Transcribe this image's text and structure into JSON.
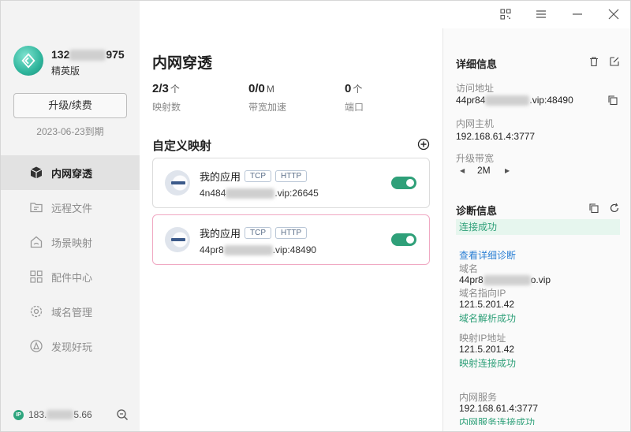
{
  "window": {
    "buttons": [
      "qrcode-icon",
      "menu-icon",
      "minimize-icon",
      "close-icon"
    ]
  },
  "sidebar": {
    "user_prefix": "132",
    "user_suffix": "975",
    "level": "精英版",
    "upgrade_label": "升级/续费",
    "expire": "2023-06-23到期",
    "items": [
      {
        "label": "内网穿透",
        "icon": "cube-icon",
        "active": true
      },
      {
        "label": "远程文件",
        "icon": "folder-icon",
        "active": false
      },
      {
        "label": "场景映射",
        "icon": "house-icon",
        "active": false
      },
      {
        "label": "配件中心",
        "icon": "grid-icon",
        "active": false
      },
      {
        "label": "域名管理",
        "icon": "gear-icon",
        "active": false
      },
      {
        "label": "发现好玩",
        "icon": "compass-icon",
        "active": false
      }
    ],
    "ip_badge": "IP",
    "ip_prefix": "183.",
    "ip_suffix": "5.66"
  },
  "main": {
    "title": "内网穿透",
    "stats": [
      {
        "value": "2/3",
        "unit": "个",
        "label": "映射数"
      },
      {
        "value": "0/0",
        "unit": "M",
        "label": "带宽加速"
      },
      {
        "value": "0",
        "unit": "个",
        "label": "端口"
      }
    ],
    "section_title": "自定义映射",
    "mappings": [
      {
        "name": "我的应用",
        "tags": [
          "TCP",
          "HTTP"
        ],
        "addr_prefix": "4n484",
        "addr_suffix": ".vip:26645",
        "enabled": true
      },
      {
        "name": "我的应用",
        "tags": [
          "TCP",
          "HTTP"
        ],
        "addr_prefix": "44pr8",
        "addr_suffix": ".vip:48490",
        "enabled": true
      }
    ]
  },
  "detail": {
    "title": "详细信息",
    "access_label": "访问地址",
    "access_prefix": "44pr84",
    "access_suffix": ".vip:48490",
    "host_label": "内网主机",
    "host_value": "192.168.61.4:3777",
    "bandwidth_label": "升级带宽",
    "bandwidth_value": "2M",
    "diag_title": "诊断信息",
    "diag_status": "连接成功",
    "diag_link": "查看详细诊断",
    "domain_label": "域名",
    "domain_prefix": "44pr8",
    "domain_suffix": "o.vip",
    "dns_label": "域名指向IP",
    "dns_ip": "121.5.201.42",
    "dns_ok": "域名解析成功",
    "map_ip_label": "映射IP地址",
    "map_ip": "121.5.201.42",
    "map_ok": "映射连接成功",
    "svc_label": "内网服务",
    "svc_value": "192.168.61.4:3777",
    "svc_ok": "内网服务连接成功"
  }
}
